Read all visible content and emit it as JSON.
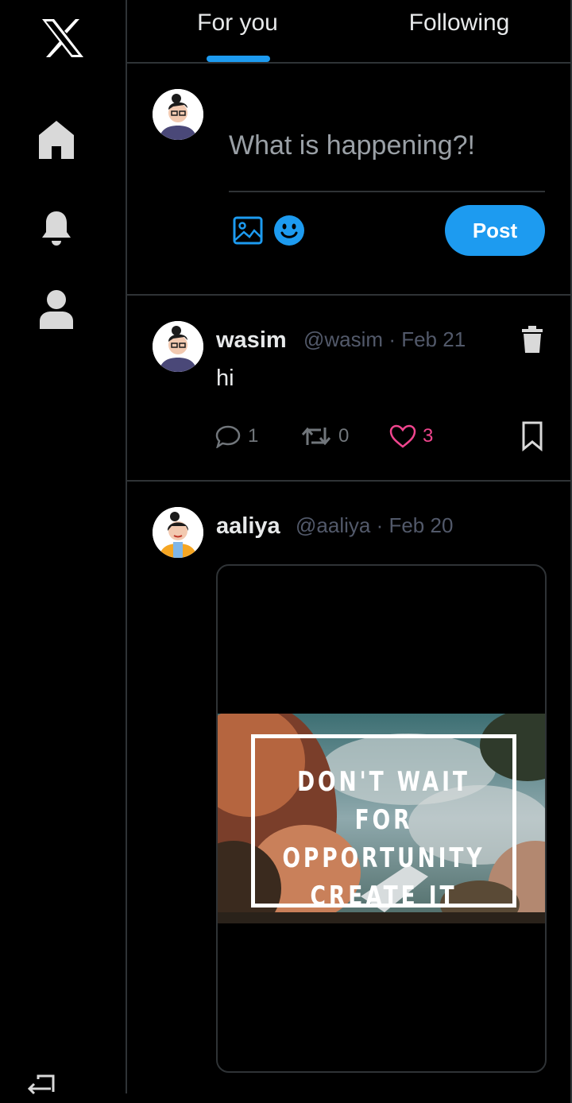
{
  "nav": {
    "logo": "x-logo-icon",
    "items": [
      {
        "name": "home",
        "icon": "home-icon"
      },
      {
        "name": "notifications",
        "icon": "bell-icon"
      },
      {
        "name": "profile",
        "icon": "user-icon"
      }
    ],
    "logout_icon": "logout-icon"
  },
  "tabs": [
    {
      "label": "For you",
      "active": true
    },
    {
      "label": "Following",
      "active": false
    }
  ],
  "composer": {
    "placeholder": "What is happening?!",
    "post_label": "Post",
    "icons": [
      "image-icon",
      "emoji-icon"
    ]
  },
  "posts": [
    {
      "name": "wasim",
      "handle": "@wasim",
      "date": "Feb 21",
      "text": "hi",
      "replies": "1",
      "reposts": "0",
      "likes": "3",
      "liked": true
    },
    {
      "name": "aaliya",
      "handle": "@aaliya",
      "date": "Feb 20",
      "image_text": [
        "DON'T WAIT FOR",
        "OPPORTUNITY",
        "CREATE IT"
      ]
    }
  ],
  "colors": {
    "accent": "#1d9bf0",
    "like": "#f0458e",
    "border": "#2f3336",
    "background": "#000000"
  }
}
